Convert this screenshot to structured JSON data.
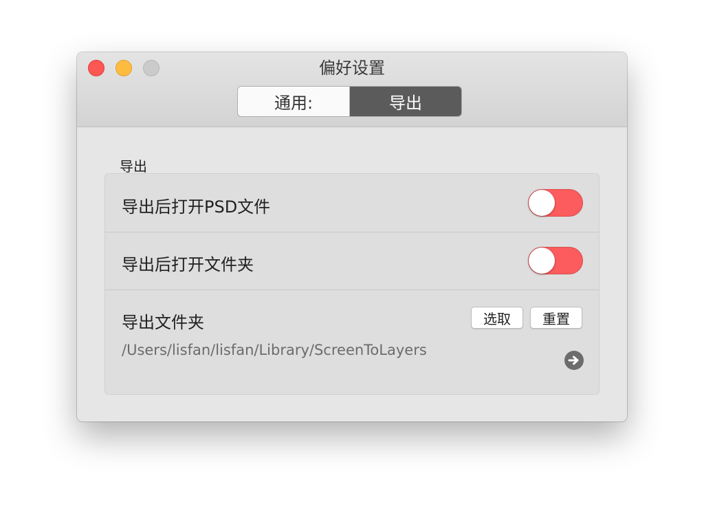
{
  "window": {
    "title": "偏好设置",
    "tabs": [
      {
        "label": "通用:",
        "selected": false
      },
      {
        "label": "导出",
        "selected": true
      }
    ]
  },
  "section": {
    "title": "导出"
  },
  "settings": {
    "open_psd": {
      "label": "导出后打开PSD文件",
      "enabled": true
    },
    "open_folder": {
      "label": "导出后打开文件夹",
      "enabled": true
    },
    "export_folder": {
      "label": "导出文件夹",
      "choose_label": "选取",
      "reset_label": "重置",
      "path": "/Users/lisfan/lisfan/Library/ScreenToLayers"
    }
  },
  "colors": {
    "toggle_on": "#fc5c5d",
    "close": "#fc5753",
    "minimize": "#fdbc40",
    "zoom": "#cbcbcb"
  },
  "icons": {
    "close": "close-icon",
    "minimize": "minimize-icon",
    "zoom": "zoom-icon",
    "reveal": "arrow-right-circle-icon"
  }
}
